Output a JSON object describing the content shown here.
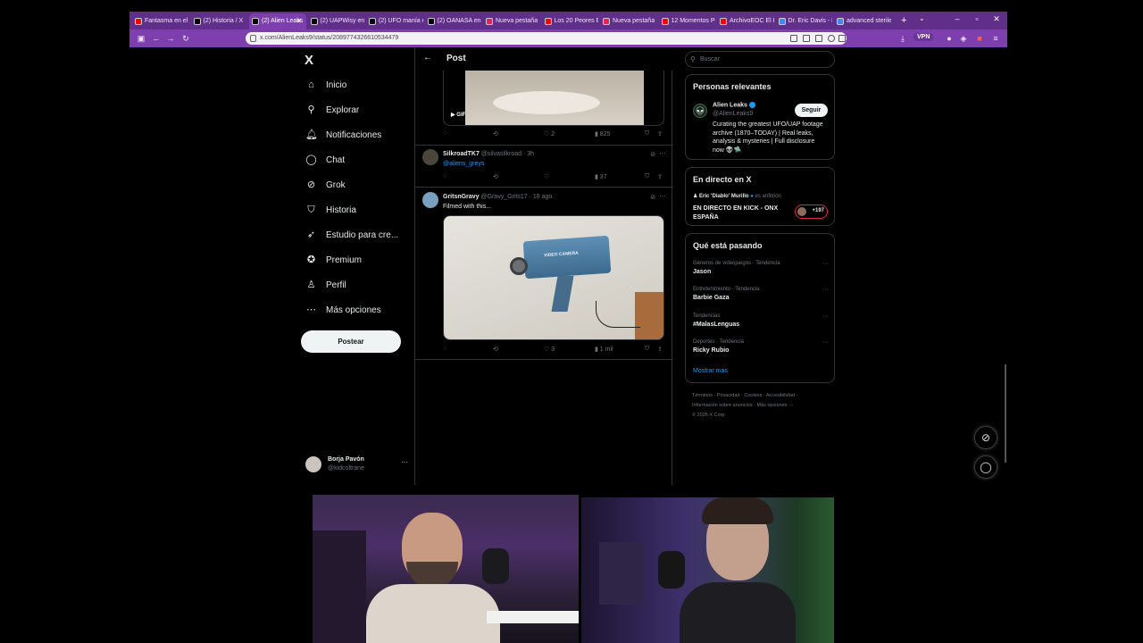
{
  "browser": {
    "tabs": [
      {
        "label": "Fantasma en el te",
        "favicon": "youtube-icon",
        "color": "#ff0000"
      },
      {
        "label": "(2) Historia / X",
        "favicon": "x-icon",
        "color": "#000000"
      },
      {
        "label": "(2) Alien Leaks",
        "favicon": "x-icon",
        "color": "#000000",
        "active": true
      },
      {
        "label": "(2) UAPWisy en X",
        "favicon": "x-icon",
        "color": "#000000"
      },
      {
        "label": "(2) UFO manía en",
        "favicon": "x-icon",
        "color": "#000000"
      },
      {
        "label": "(2) OANASA en X",
        "favicon": "x-icon",
        "color": "#000000"
      },
      {
        "label": "Nueva pestaña",
        "favicon": "opera-icon",
        "color": "#e0245e"
      },
      {
        "label": "Los 20 Peores Enc",
        "favicon": "youtube-icon",
        "color": "#ff0000"
      },
      {
        "label": "Nueva pestaña",
        "favicon": "opera-icon",
        "color": "#e0245e"
      },
      {
        "label": "12 Momentos Per",
        "favicon": "youtube-icon",
        "color": "#ff0000"
      },
      {
        "label": "ArchivoEOC El Pc",
        "favicon": "youtube-icon",
        "color": "#ff0000"
      },
      {
        "label": "Dr. Eric Davis - Br",
        "favicon": "google-icon",
        "color": "#4285f4"
      },
      {
        "label": "advanced sterile s",
        "favicon": "google-icon",
        "color": "#4285f4"
      }
    ],
    "url": "x.com/AlienLeaks9/status/2089774326610534479",
    "vpn_label": "VPN"
  },
  "sidebar": {
    "logo": "X",
    "items": [
      {
        "label": "Inicio",
        "icon": "home-icon"
      },
      {
        "label": "Explorar",
        "icon": "search-icon"
      },
      {
        "label": "Notificaciones",
        "icon": "bell-icon"
      },
      {
        "label": "Chat",
        "icon": "chat-icon"
      },
      {
        "label": "Grok",
        "icon": "grok-icon"
      },
      {
        "label": "Historia",
        "icon": "bookmark-icon"
      },
      {
        "label": "Estudio para cre...",
        "icon": "rocket-icon"
      },
      {
        "label": "Premium",
        "icon": "premium-icon"
      },
      {
        "label": "Perfil",
        "icon": "person-icon"
      },
      {
        "label": "Más opciones",
        "icon": "more-icon"
      }
    ],
    "post_button": "Postear",
    "account": {
      "name": "Borja Pavón",
      "handle": "@kidcoltrane"
    }
  },
  "header": {
    "title": "Post"
  },
  "feed": {
    "first_media": {
      "badge": "GIF",
      "replies": "",
      "likes": "2",
      "views": "825"
    },
    "tweets": [
      {
        "name": "SilkroadTK7",
        "handle": "@silvasilkroad",
        "time": "· 3h",
        "text": "@aliens_greys",
        "views": "37"
      },
      {
        "name": "GritsnGravy",
        "handle": "@Gravy_Grits17",
        "time": "· 18 ago.",
        "text": "Filmed with this...",
        "media_label": "VIDEO CAMERA",
        "likes": "3",
        "views": "1 mil"
      }
    ]
  },
  "right": {
    "search_placeholder": "Buscar",
    "relevant": {
      "title": "Personas relevantes",
      "name": "Alien Leaks",
      "handle": "@AlienLeaks9",
      "bio": "Curating the greatest UFO/UAP footage archive (1870–TODAY) | Real leaks, analysis & mysteries | Full disclosure now 👽🛸",
      "follow": "Seguir"
    },
    "live": {
      "title": "En directo en X",
      "host": "Eric 'Diablo' Murillo",
      "host_suffix": "es anfitrión",
      "stream": "EN DIRECTO EN KICK - ONX ESPAÑA",
      "count": "+197"
    },
    "trends_title": "Qué está pasando",
    "trends": [
      {
        "context": "Géneros de videojuegos · Tendencia",
        "name": "Jason"
      },
      {
        "context": "Entretenimiento · Tendencia",
        "name": "Barbie Gaza"
      },
      {
        "context": "Tendencias",
        "name": "#MalasLenguas"
      },
      {
        "context": "Deportes · Tendencia",
        "name": "Ricky Rubio"
      }
    ],
    "show_more": "Mostrar más",
    "footer_line1": "Términos · Privacidad · Cookies · Accesibilidad ·",
    "footer_line2": "Información sobre anuncios · Más opciones ···",
    "footer_line3": "© 2025 X Corp."
  }
}
